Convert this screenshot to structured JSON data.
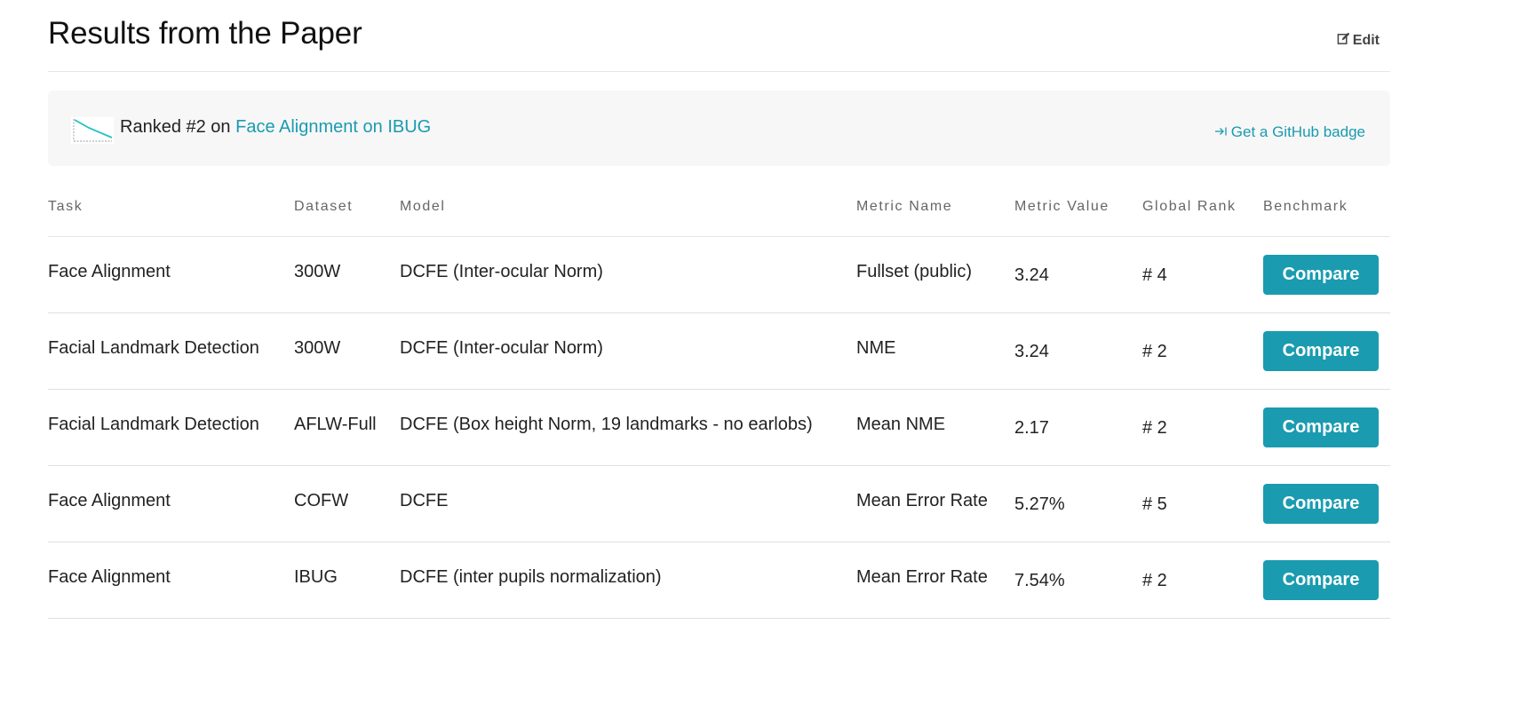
{
  "header": {
    "title": "Results from the Paper",
    "edit_label": "Edit"
  },
  "banner": {
    "ranked_prefix": "Ranked #2 on",
    "ranked_link": "Face Alignment on IBUG",
    "badge_label": "Get a GitHub badge"
  },
  "table": {
    "columns": [
      "Task",
      "Dataset",
      "Model",
      "Metric Name",
      "Metric Value",
      "Global Rank",
      "Benchmark"
    ],
    "rows": [
      {
        "task": "Face Alignment",
        "dataset": "300W",
        "model": "DCFE (Inter-ocular Norm)",
        "metric_name": "Fullset (public)",
        "metric_value": "3.24",
        "global_rank": "# 4",
        "benchmark": "Compare"
      },
      {
        "task": "Facial Landmark Detection",
        "dataset": "300W",
        "model": "DCFE (Inter-ocular Norm)",
        "metric_name": "NME",
        "metric_value": "3.24",
        "global_rank": "# 2",
        "benchmark": "Compare"
      },
      {
        "task": "Facial Landmark Detection",
        "dataset": "AFLW-Full",
        "model": "DCFE (Box height Norm, 19 landmarks - no earlobs)",
        "metric_name": "Mean NME",
        "metric_value": "2.17",
        "global_rank": "# 2",
        "benchmark": "Compare"
      },
      {
        "task": "Face Alignment",
        "dataset": "COFW",
        "model": "DCFE",
        "metric_name": "Mean Error Rate",
        "metric_value": "5.27%",
        "global_rank": "# 5",
        "benchmark": "Compare"
      },
      {
        "task": "Face Alignment",
        "dataset": "IBUG",
        "model": "DCFE (inter pupils normalization)",
        "metric_name": "Mean Error Rate",
        "metric_value": "7.54%",
        "global_rank": "# 2",
        "benchmark": "Compare"
      }
    ]
  },
  "colors": {
    "accent": "#1a9bb0",
    "banner_bg": "#f7f7f7",
    "divider": "#e0e0e0"
  },
  "icons": {
    "edit": "edit-icon",
    "badge": "arrow-to-right-icon",
    "thumbnail": "trend-chart-icon"
  }
}
